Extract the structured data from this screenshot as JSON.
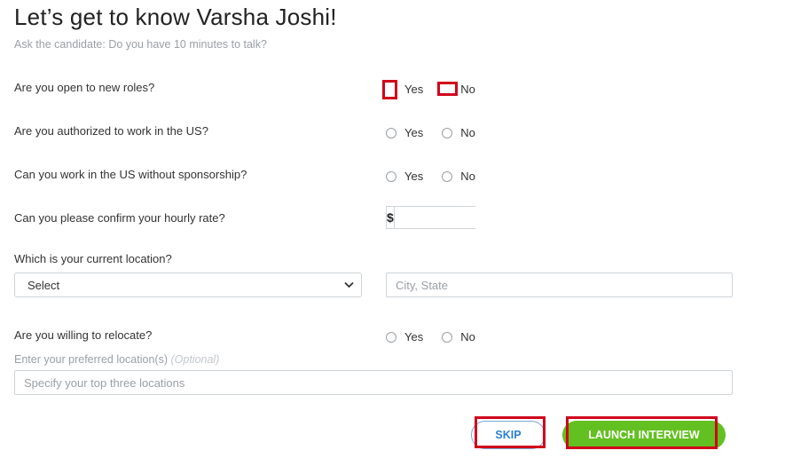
{
  "header": {
    "title": "Let’s get to know Varsha Joshi!",
    "subtitle": "Ask the candidate: Do you have 10 minutes to talk?"
  },
  "questions": {
    "open_roles": {
      "label": "Are you open to new roles?",
      "yes": "Yes",
      "no": "No"
    },
    "authorized": {
      "label": "Are you authorized to work in the US?",
      "yes": "Yes",
      "no": "No"
    },
    "sponsorship": {
      "label": "Can you work in the US without sponsorship?",
      "yes": "Yes",
      "no": "No"
    },
    "hourly_rate": {
      "label": "Can you please confirm your hourly rate?",
      "prefix": "$",
      "value": ""
    },
    "location": {
      "label": "Which is your current location?",
      "select_value": "Select",
      "city_placeholder": "City, State"
    },
    "relocate": {
      "label": "Are you willing to relocate?",
      "yes": "Yes",
      "no": "No"
    },
    "preferred": {
      "label": "Enter your preferred location(s)",
      "optional": "(Optional)",
      "placeholder": "Specify your top three locations"
    }
  },
  "actions": {
    "skip_label": "SKIP",
    "launch_label": "LAUNCH INTERVIEW"
  },
  "colors": {
    "accent_green": "#62c020",
    "accent_blue": "#2a7fd4",
    "highlight_red": "#d0021b"
  }
}
